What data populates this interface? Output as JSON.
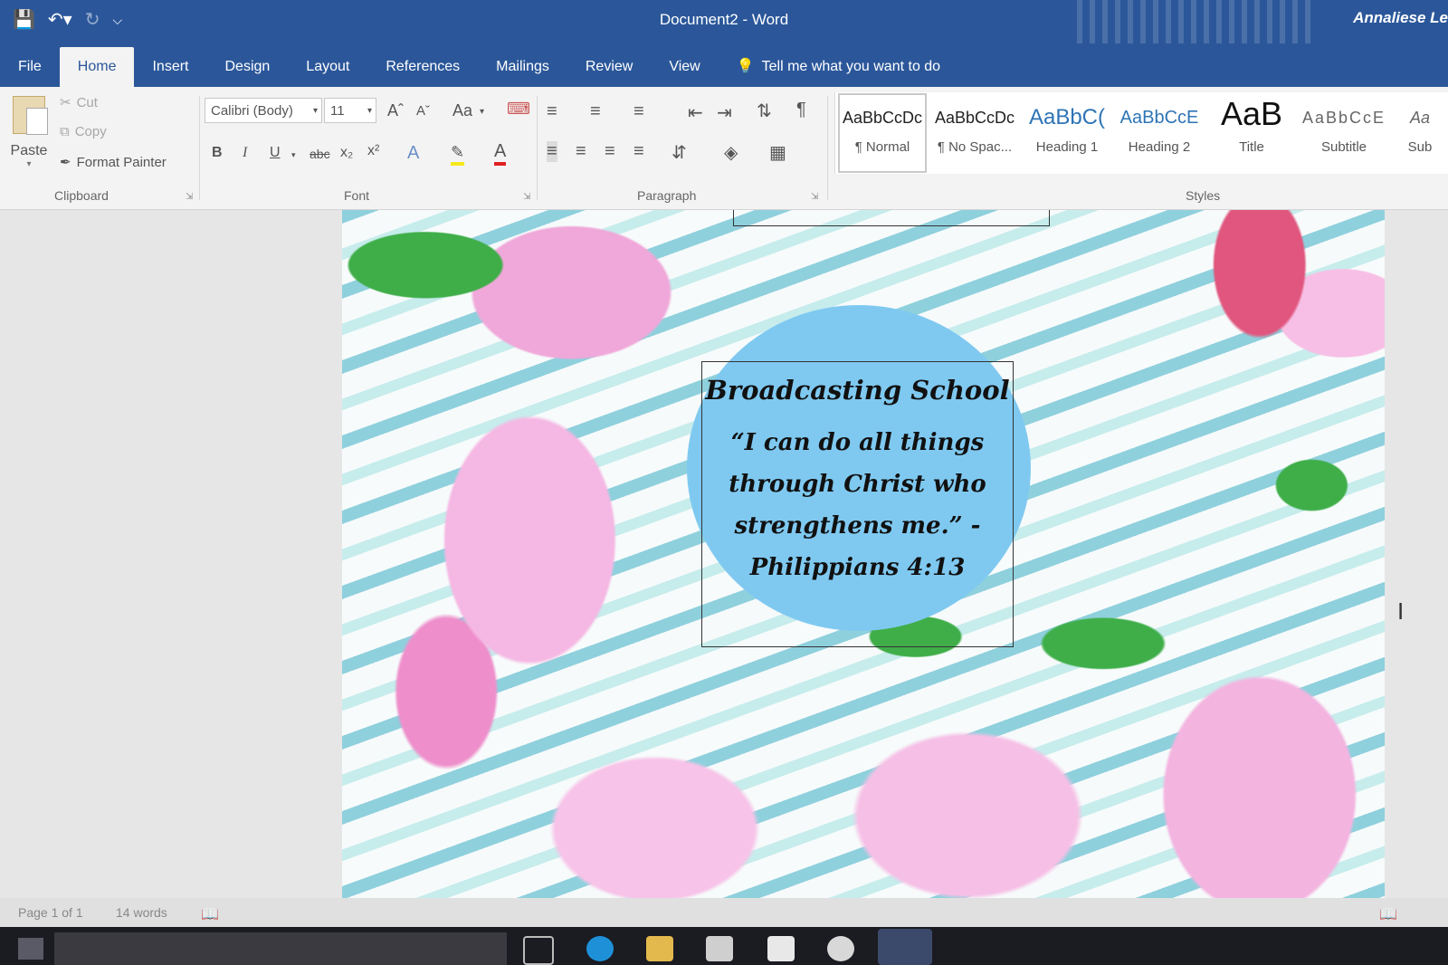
{
  "window": {
    "title": "Document2 - Word",
    "user": "Annaliese Le"
  },
  "qat": {
    "save_icon": "save-icon",
    "undo_icon": "undo-icon",
    "redo_icon": "redo-icon",
    "customize_icon": "customize-icon"
  },
  "tabs": [
    "File",
    "Home",
    "Insert",
    "Design",
    "Layout",
    "References",
    "Mailings",
    "Review",
    "View"
  ],
  "active_tab": "Home",
  "tell_me": "Tell me what you want to do",
  "clipboard": {
    "paste": "Paste",
    "cut": "Cut",
    "copy": "Copy",
    "format_painter": "Format Painter",
    "label": "Clipboard"
  },
  "font": {
    "family": "Calibri (Body)",
    "size": "11",
    "label": "Font",
    "change_case": "Aa",
    "bold": "B",
    "italic": "I",
    "underline": "U",
    "strike": "abc",
    "sub": "x₂",
    "sup": "x²"
  },
  "paragraph": {
    "label": "Paragraph"
  },
  "styles": {
    "label": "Styles",
    "items": [
      {
        "preview": "AaBbCcDc",
        "name": "¶ Normal"
      },
      {
        "preview": "AaBbCcDc",
        "name": "¶ No Spac..."
      },
      {
        "preview": "AaBbC(",
        "name": "Heading 1"
      },
      {
        "preview": "AaBbCcE",
        "name": "Heading 2"
      },
      {
        "preview": "AaB",
        "name": "Title"
      },
      {
        "preview": "AaBbCcE",
        "name": "Subtitle"
      },
      {
        "preview": "Aa",
        "name": "Sub"
      }
    ]
  },
  "document": {
    "heading": "Broadcasting School",
    "quote_lines": [
      "“I can do all things",
      "through Christ who",
      "strengthens me.” -",
      "Philippians 4:13"
    ]
  },
  "status": {
    "page": "Page 1 of 1",
    "words": "14 words"
  },
  "colors": {
    "accent": "#2b579a",
    "circle": "#7fc9f1"
  }
}
